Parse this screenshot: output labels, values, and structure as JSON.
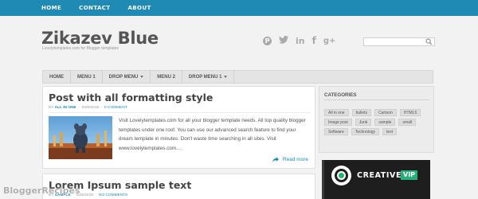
{
  "top_nav": [
    "HOME",
    "CONTACT",
    "ABOUT"
  ],
  "site": {
    "title": "Zikazev Blue",
    "subtitle": "Lovelytemplates.com for Blogger templates"
  },
  "social_icons": [
    "pinterest-icon",
    "twitter-icon",
    "linkedin-icon",
    "facebook-icon",
    "google-plus-icon"
  ],
  "search": {
    "placeholder": ""
  },
  "main_menu": [
    {
      "label": "HOME",
      "dropdown": false
    },
    {
      "label": "MENU 1",
      "dropdown": false
    },
    {
      "label": "DROP MENU",
      "dropdown": true
    },
    {
      "label": "MENU 2",
      "dropdown": false
    },
    {
      "label": "DROP MENU 1",
      "dropdown": true
    }
  ],
  "posts": [
    {
      "title": "Post with all formatting style",
      "author_prefix": "BY",
      "author": "ALL IN ONE",
      "date": "04/6/2018",
      "comments": "0 COMMENT",
      "excerpt": "Visit Lovelytemplates.com for all your blogger template needs. All top quality blogger templates under one roof. You can use our advanced search feature to find your dream template in minutes. Don't waste time searching in all sites. Visit www.lovelytemplates.com....",
      "read_more": "Read more"
    },
    {
      "title": "Lorem Ipsum sample text",
      "author_prefix": "BY",
      "author": "SAMPLE",
      "date": "04/5/2018",
      "comments": "NO COMMENTS"
    }
  ],
  "categories_widget": {
    "title": "CATEGORIES",
    "tags": [
      "All in one",
      "bullets",
      "Cartoon",
      "HTML5",
      "Image post",
      "Junk",
      "sample",
      "small",
      "Software",
      "Technology",
      "text"
    ]
  },
  "ad": {
    "brand": "CREATIVE",
    "badge": "VIP"
  },
  "watermark": "BloggerRecipes",
  "colors": {
    "accent": "#1f8ab4",
    "ad_green": "#27b07a"
  }
}
